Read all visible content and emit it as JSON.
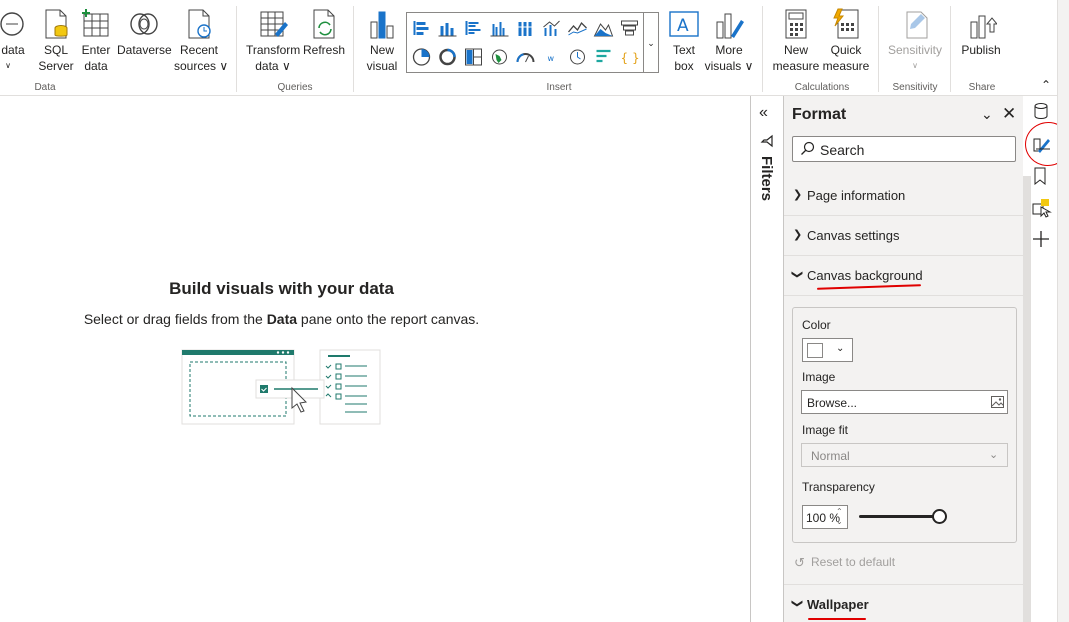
{
  "ribbon": {
    "groups": {
      "data": "Data",
      "queries": "Queries",
      "insert": "Insert",
      "calculations": "Calculations",
      "sensitivity": "Sensitivity",
      "share": "Share"
    },
    "buttons": {
      "excel_data": [
        "e data",
        "∨"
      ],
      "sql_server": [
        "SQL",
        "Server"
      ],
      "enter_data": [
        "Enter",
        "data"
      ],
      "dataverse": [
        "Dataverse",
        ""
      ],
      "recent_sources": [
        "Recent",
        "sources ∨"
      ],
      "transform_data": [
        "Transform",
        "data ∨"
      ],
      "refresh": [
        "Refresh",
        ""
      ],
      "new_visual": [
        "New",
        "visual"
      ],
      "text_box": [
        "Text",
        "box"
      ],
      "more_visuals": [
        "More",
        "visuals ∨"
      ],
      "new_measure": [
        "New",
        "measure"
      ],
      "quick_measure": [
        "Quick",
        "measure"
      ],
      "sensitivity": [
        "Sensitivity",
        "∨"
      ],
      "publish": [
        "Publish",
        ""
      ]
    }
  },
  "canvas": {
    "title": "Build visuals with your data",
    "subtitle_pre": "Select or drag fields from the ",
    "subtitle_bold": "Data",
    "subtitle_post": " pane onto the report canvas."
  },
  "filters": {
    "label": "Filters"
  },
  "format_pane": {
    "title": "Format",
    "search_placeholder": "Search",
    "sections": [
      {
        "label": "Page information",
        "expanded": false
      },
      {
        "label": "Canvas settings",
        "expanded": false
      },
      {
        "label": "Canvas background",
        "expanded": true
      }
    ],
    "canvas_background": {
      "color_label": "Color",
      "color_value": "#ffffff",
      "image_label": "Image",
      "image_value": "Browse...",
      "image_fit_label": "Image fit",
      "image_fit_value": "Normal",
      "transparency_label": "Transparency",
      "transparency_value": "100 %",
      "transparency_level": 1.0,
      "reset_label": "Reset to default"
    },
    "wallpaper_label": "Wallpaper"
  },
  "colors": {
    "accent_green": "#1f7a6c",
    "annotation_red": "#e00000",
    "pane_bg": "#f3f2f1"
  },
  "icons": {
    "data": "database-icon",
    "format": "paint-brush-icon",
    "bookmarks": "bookmark-icon",
    "selection": "selection-icon",
    "add": "plus-icon"
  }
}
